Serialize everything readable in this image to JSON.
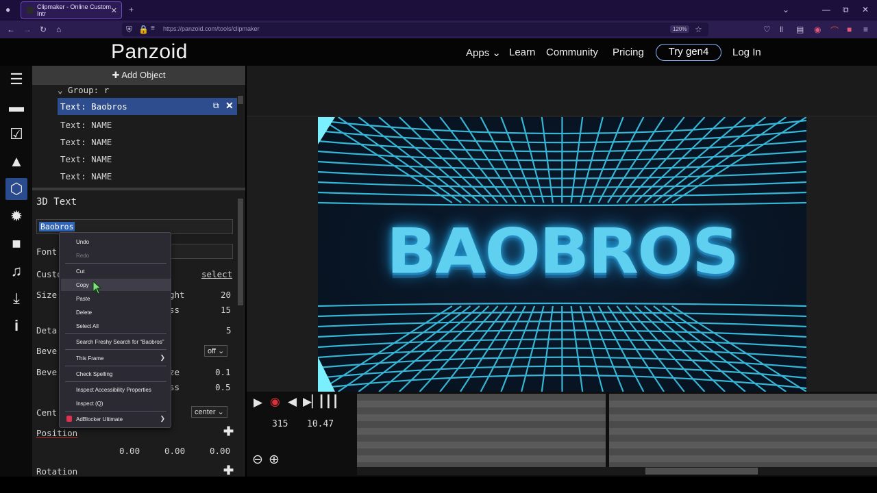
{
  "browser": {
    "tab_title": "Clipmaker - Online Custom Intr",
    "new_tab": "+",
    "url": "https://panzoid.com/tools/clipmaker",
    "zoom": "120%"
  },
  "site": {
    "logo": "Panzoid",
    "menu": {
      "apps": "Apps ⌄",
      "learn": "Learn",
      "community": "Community",
      "pricing": "Pricing",
      "try": "Try gen4",
      "login": "Log In"
    }
  },
  "sidebar": {
    "items": [
      "menu-icon",
      "folder-icon",
      "checkbox-icon",
      "image-icon",
      "cube-icon",
      "burst-icon",
      "camera-icon",
      "music-icon",
      "download-icon",
      "info-icon"
    ]
  },
  "panel": {
    "add_object": "✚ Add Object",
    "tree": {
      "group": "⌄ Group: r",
      "items": [
        "Text: Baobros",
        "Text: NAME",
        "Text: NAME",
        "Text: NAME",
        "Text: NAME"
      ]
    },
    "props": {
      "title": "3D Text",
      "text_value": "Baobros",
      "font_label": "Font",
      "custom_label": "Custo",
      "select_link": "select",
      "size_label": "Size",
      "height_label": "ght",
      "height_val": "20",
      "thickness_label": "ss",
      "thickness_val": "15",
      "detail_label": "Deta",
      "detail_val": "5",
      "bevel_label": "Beve",
      "bevel_dropdown": "off ⌄",
      "bevel2_label": "Beve",
      "bevel_size_label": "ze",
      "bevel_size_val": "0.1",
      "bevel_thick_label": "ss",
      "bevel_thick_val": "0.5",
      "center_label": "Cent",
      "center_dropdown": "center ⌄",
      "position_label": "Position",
      "position_vals": [
        "0.00",
        "0.00",
        "0.00"
      ],
      "rotation_label": "Rotation"
    }
  },
  "context_menu": {
    "undo": "Undo",
    "redo": "Redo",
    "cut": "Cut",
    "copy": "Copy",
    "paste": "Paste",
    "delete": "Delete",
    "select_all": "Select All",
    "search": "Search Freshy Search for “Baobros”",
    "this_frame": "This Frame",
    "spelling": "Check Spelling",
    "a11y": "Inspect Accessibility Properties",
    "inspect": "Inspect (Q)",
    "adblock": "AdBlocker Ultimate"
  },
  "preview": {
    "big_text": "BAOBROS"
  },
  "timeline": {
    "frame": "315",
    "time": "10.47"
  }
}
